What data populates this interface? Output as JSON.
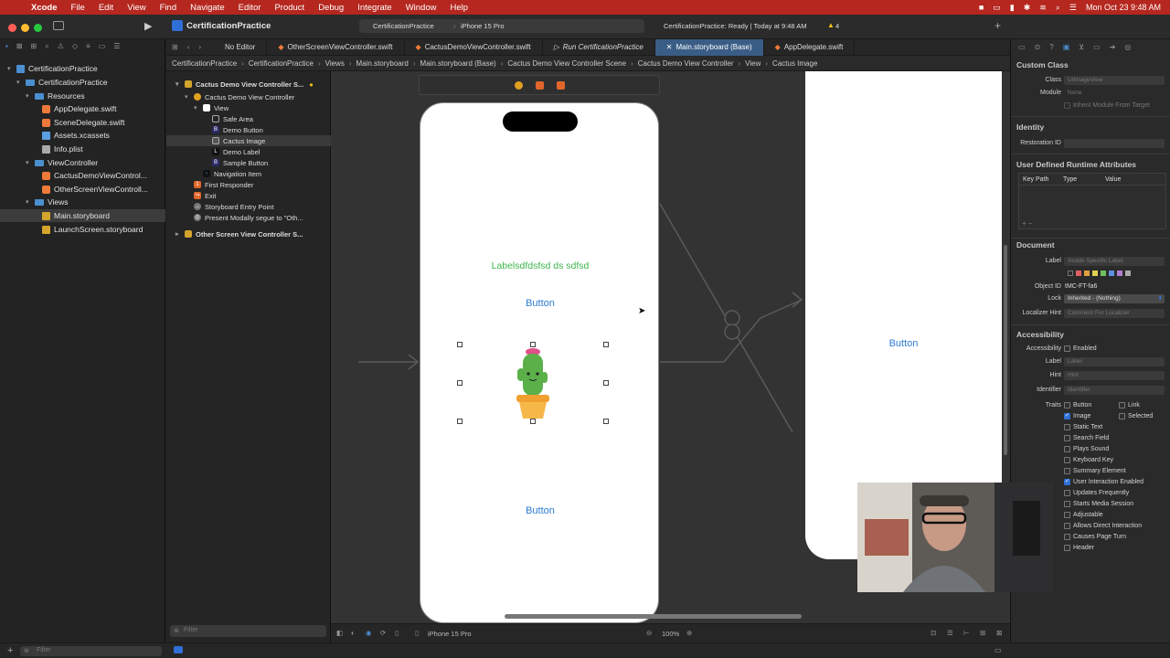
{
  "menubar": {
    "app": "Xcode",
    "items": [
      "File",
      "Edit",
      "View",
      "Find",
      "Navigate",
      "Editor",
      "Product",
      "Debug",
      "Integrate",
      "Window",
      "Help"
    ],
    "clock": "Mon Oct 23  9:48 AM"
  },
  "toolbar": {
    "project": "CertificationPractice",
    "scheme": "CertificationPractice",
    "device": "iPhone 15 Pro",
    "status": "CertificationPractice: Ready | Today at 9:48 AM",
    "warnings": "4"
  },
  "tabs": [
    {
      "label": "No Editor",
      "active": false
    },
    {
      "label": "OtherScreenViewController.swift",
      "active": false
    },
    {
      "label": "CactusDemoViewController.swift",
      "active": false
    },
    {
      "label": "Run CertificationPractice",
      "active": false
    },
    {
      "label": "Main.storyboard (Base)",
      "active": true
    },
    {
      "label": "AppDelegate.swift",
      "active": false
    }
  ],
  "jumpbar": [
    "CertificationPractice",
    "CertificationPractice",
    "Views",
    "Main.storyboard",
    "Main.storyboard (Base)",
    "Cactus Demo View Controller Scene",
    "Cactus Demo View Controller",
    "View",
    "Cactus Image"
  ],
  "navigator": {
    "root": "CertificationPractice",
    "group": "CertificationPractice",
    "resources": "Resources",
    "app_delegate": "AppDelegate.swift",
    "scene_delegate": "SceneDelegate.swift",
    "assets": "Assets.xcassets",
    "info": "Info.plist",
    "viewcontroller": "ViewController",
    "cactus_vc": "CactusDemoViewControl...",
    "other_vc": "OtherScreenViewControll...",
    "views": "Views",
    "main_storyboard": "Main.storyboard",
    "launch_screen": "LaunchScreen.storyboard",
    "filter_placeholder": "Filter"
  },
  "outline": {
    "scene": "Cactus Demo View Controller S...",
    "vc": "Cactus Demo View Controller",
    "view": "View",
    "safe_area": "Safe Area",
    "demo_button": "Demo Button",
    "cactus_image": "Cactus Image",
    "demo_label": "Demo Label",
    "sample_button": "Sample Button",
    "nav_item": "Navigation Item",
    "first_responder": "First Responder",
    "exit": "Exit",
    "entry_point": "Storyboard Entry Point",
    "segue": "Present Modally segue to \"Oth...",
    "other_scene": "Other Screen View Controller S...",
    "filter_placeholder": "Filter"
  },
  "canvas": {
    "label_text": "Labelsdfdsfsd ds sdfsd",
    "button_top": "Button",
    "button_bottom": "Button",
    "button_right": "Button",
    "device": "iPhone 15 Pro",
    "zoom": "100%"
  },
  "inspector": {
    "custom_class_header": "Custom Class",
    "class_label": "Class",
    "class_value": "UIImageView",
    "module_label": "Module",
    "module_value": "None",
    "inherit_label": "Inherit Module From Target",
    "identity_header": "Identity",
    "restoration_label": "Restoration ID",
    "udra_header": "User Defined Runtime Attributes",
    "udra_cols": [
      "Key Path",
      "Type",
      "Value"
    ],
    "document_header": "Document",
    "doc_label": "Label",
    "doc_label_placeholder": "Xcode Specific Label",
    "object_id_label": "Object ID",
    "object_id": "tMC-FT-fa6",
    "lock_label": "Lock",
    "lock_value": "Inherited - (Nothing)",
    "localizer_label": "Localizer Hint",
    "localizer_placeholder": "Comment For Localizer",
    "accessibility_header": "Accessibility",
    "acc_label": "Accessibility",
    "acc_enabled": "Enabled",
    "acc_label_label": "Label",
    "acc_label_placeholder": "Label",
    "hint_label": "Hint",
    "hint_placeholder": "Hint",
    "identifier_label": "Identifier",
    "identifier_placeholder": "Identifier",
    "traits_label": "Traits",
    "traits": [
      {
        "label": "Button",
        "checked": false
      },
      {
        "label": "Link",
        "checked": false
      },
      {
        "label": "Image",
        "checked": true
      },
      {
        "label": "Selected",
        "checked": false
      },
      {
        "label": "Static Text",
        "checked": false
      },
      {
        "label": "Search Field",
        "checked": false
      },
      {
        "label": "Plays Sound",
        "checked": false
      },
      {
        "label": "Keyboard Key",
        "checked": false
      },
      {
        "label": "Summary Element",
        "checked": false
      },
      {
        "label": "User Interaction Enabled",
        "checked": true
      },
      {
        "label": "Updates Frequently",
        "checked": false
      },
      {
        "label": "Starts Media Session",
        "checked": false
      },
      {
        "label": "Adjustable",
        "checked": false
      },
      {
        "label": "Allows Direct Interaction",
        "checked": false
      },
      {
        "label": "Causes Page Turn",
        "checked": false
      },
      {
        "label": "Header",
        "checked": false
      }
    ]
  },
  "colors": {
    "menubar": "#b5271f",
    "accent": "#2f6fd6",
    "label_green": "#3cb54a",
    "button_blue": "#2f7bd0"
  }
}
